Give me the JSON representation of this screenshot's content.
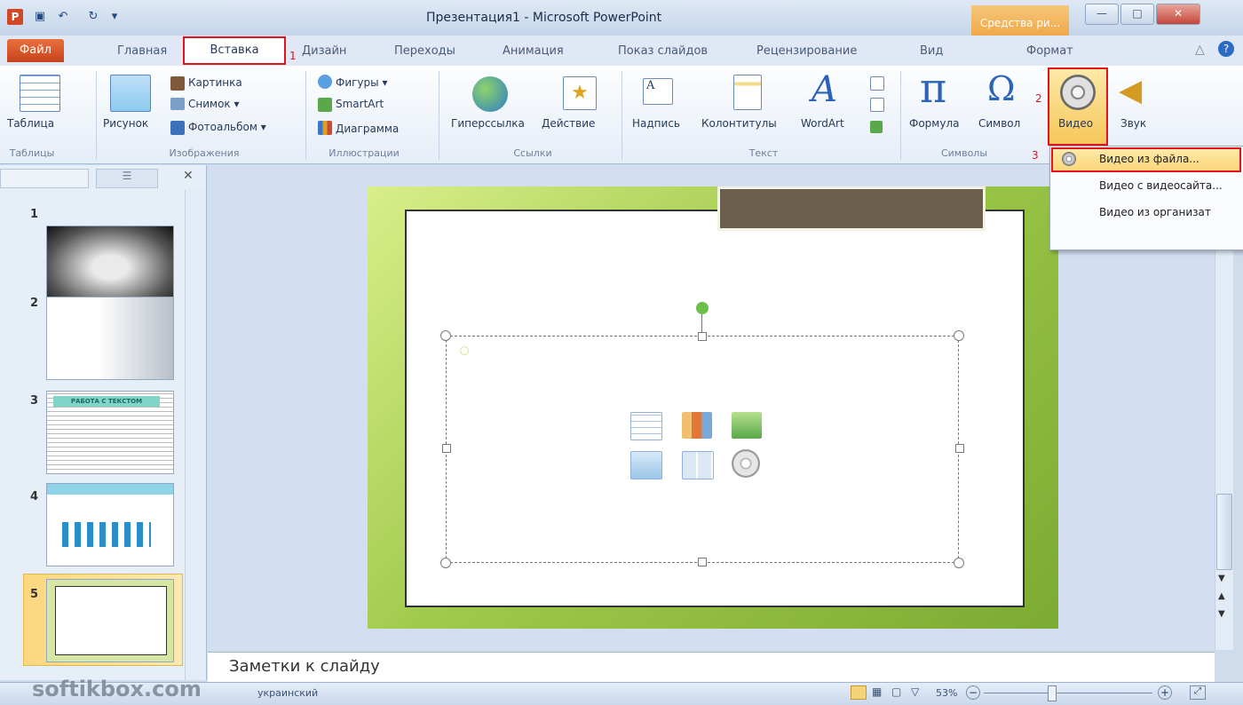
{
  "window": {
    "title": "Презентация1 - Microsoft PowerPoint",
    "context_tab": "Средства ри...",
    "app_icon_letter": "P",
    "controls": {
      "minimize": "—",
      "maximize": "□",
      "close": "✕"
    }
  },
  "tabs": {
    "file": "Файл",
    "home": "Главная",
    "insert": "Вставка",
    "design": "Дизайн",
    "transitions": "Переходы",
    "animations": "Анимация",
    "slideshow": "Показ слайдов",
    "review": "Рецензирование",
    "view": "Вид",
    "format": "Формат"
  },
  "step_markers": {
    "one": "1",
    "two": "2",
    "three": "3"
  },
  "ribbon": {
    "tables": {
      "group": "Таблицы",
      "table": "Таблица"
    },
    "images": {
      "group": "Изображения",
      "picture": "Рисунок",
      "clipart": "Картинка",
      "screenshot": "Снимок ▾",
      "album": "Фотоальбом ▾"
    },
    "illustrations": {
      "group": "Иллюстрации",
      "shapes": "Фигуры ▾",
      "smartart": "SmartArt",
      "chart": "Диаграмма"
    },
    "links": {
      "group": "Ссылки",
      "hyperlink": "Гиперссылка",
      "action": "Действие"
    },
    "text": {
      "group": "Текст",
      "textbox": "Надпись",
      "header_footer": "Колонтитулы",
      "wordart": "WordArt"
    },
    "symbols": {
      "group": "Символы",
      "equation": "Формула",
      "symbol": "Символ"
    },
    "media": {
      "video": "Видео",
      "audio": "Звук"
    }
  },
  "video_menu": {
    "items": [
      "Видео из файла...",
      "Видео с видеосайта...",
      "Видео из организат"
    ]
  },
  "slides": {
    "numbers": [
      "1",
      "2",
      "3",
      "4",
      "5"
    ],
    "thumb3_heading": "РАБОТА С ТЕКСТОМ"
  },
  "notes": {
    "placeholder": "Заметки к слайду"
  },
  "status": {
    "language": "украинский",
    "zoom": "53%",
    "watermark": "softikbox.com"
  },
  "colors": {
    "accent_red": "#e2131d",
    "file_tab": "#d04a1f",
    "slide_green": "#9ec94a",
    "title_placeholder": "#6b5e4d"
  }
}
